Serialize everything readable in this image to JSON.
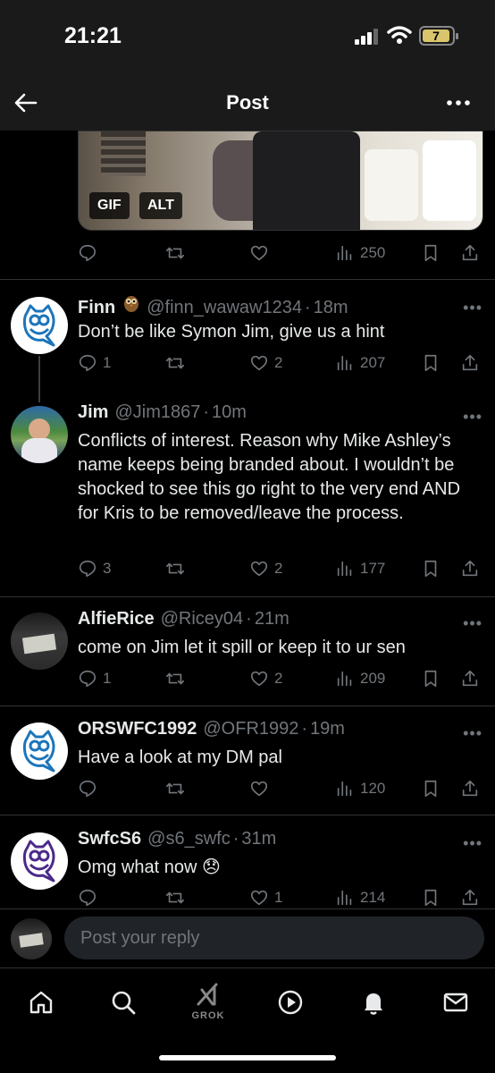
{
  "status_bar": {
    "time": "21:21",
    "battery": "7"
  },
  "header": {
    "title": "Post"
  },
  "media": {
    "gif_label": "GIF",
    "alt_label": "ALT"
  },
  "original_post": {
    "views": "250"
  },
  "replies": [
    {
      "name": "Finn",
      "handle": "@finn_wawaw1234",
      "time": "18m",
      "text": "Don’t be like Symon Jim, give us a hint",
      "replies": "1",
      "reposts": "",
      "likes": "2",
      "views": "207"
    },
    {
      "name": "Jim",
      "handle": "@Jim1867",
      "time": "10m",
      "text": "Conflicts of interest. Reason why Mike Ashley’s name keeps being branded about. I wouldn’t be shocked to see this go right to the very end AND for Kris to be removed/leave the process.",
      "replies": "3",
      "reposts": "",
      "likes": "2",
      "views": "177"
    },
    {
      "name": "AlfieRice",
      "handle": "@Ricey04",
      "time": "21m",
      "text": "come on Jim let it spill or keep it to ur sen",
      "replies": "1",
      "reposts": "",
      "likes": "2",
      "views": "209"
    },
    {
      "name": "ORSWFC1992",
      "handle": "@OFR1992",
      "time": "19m",
      "text": "Have a look at my DM pal",
      "replies": "",
      "reposts": "",
      "likes": "",
      "views": "120"
    },
    {
      "name": "SwfcS6",
      "handle": "@s6_swfc",
      "time": "31m",
      "text": "Omg what now 😞",
      "replies": "",
      "reposts": "",
      "likes": "1",
      "views": "214"
    }
  ],
  "composer": {
    "placeholder": "Post your reply"
  },
  "tabbar": {
    "grok_label": "GROK"
  },
  "icons": [
    "back-arrow-icon",
    "more-icon",
    "reply-icon",
    "repost-icon",
    "like-icon",
    "views-icon",
    "bookmark-icon",
    "share-icon",
    "owl-icon",
    "home-icon",
    "search-icon",
    "grok-icon",
    "video-icon",
    "bell-icon",
    "mail-icon"
  ],
  "colors": {
    "background": "#000000",
    "text": "#e7e9ea",
    "muted": "#71767b",
    "divider": "#2f3336"
  }
}
